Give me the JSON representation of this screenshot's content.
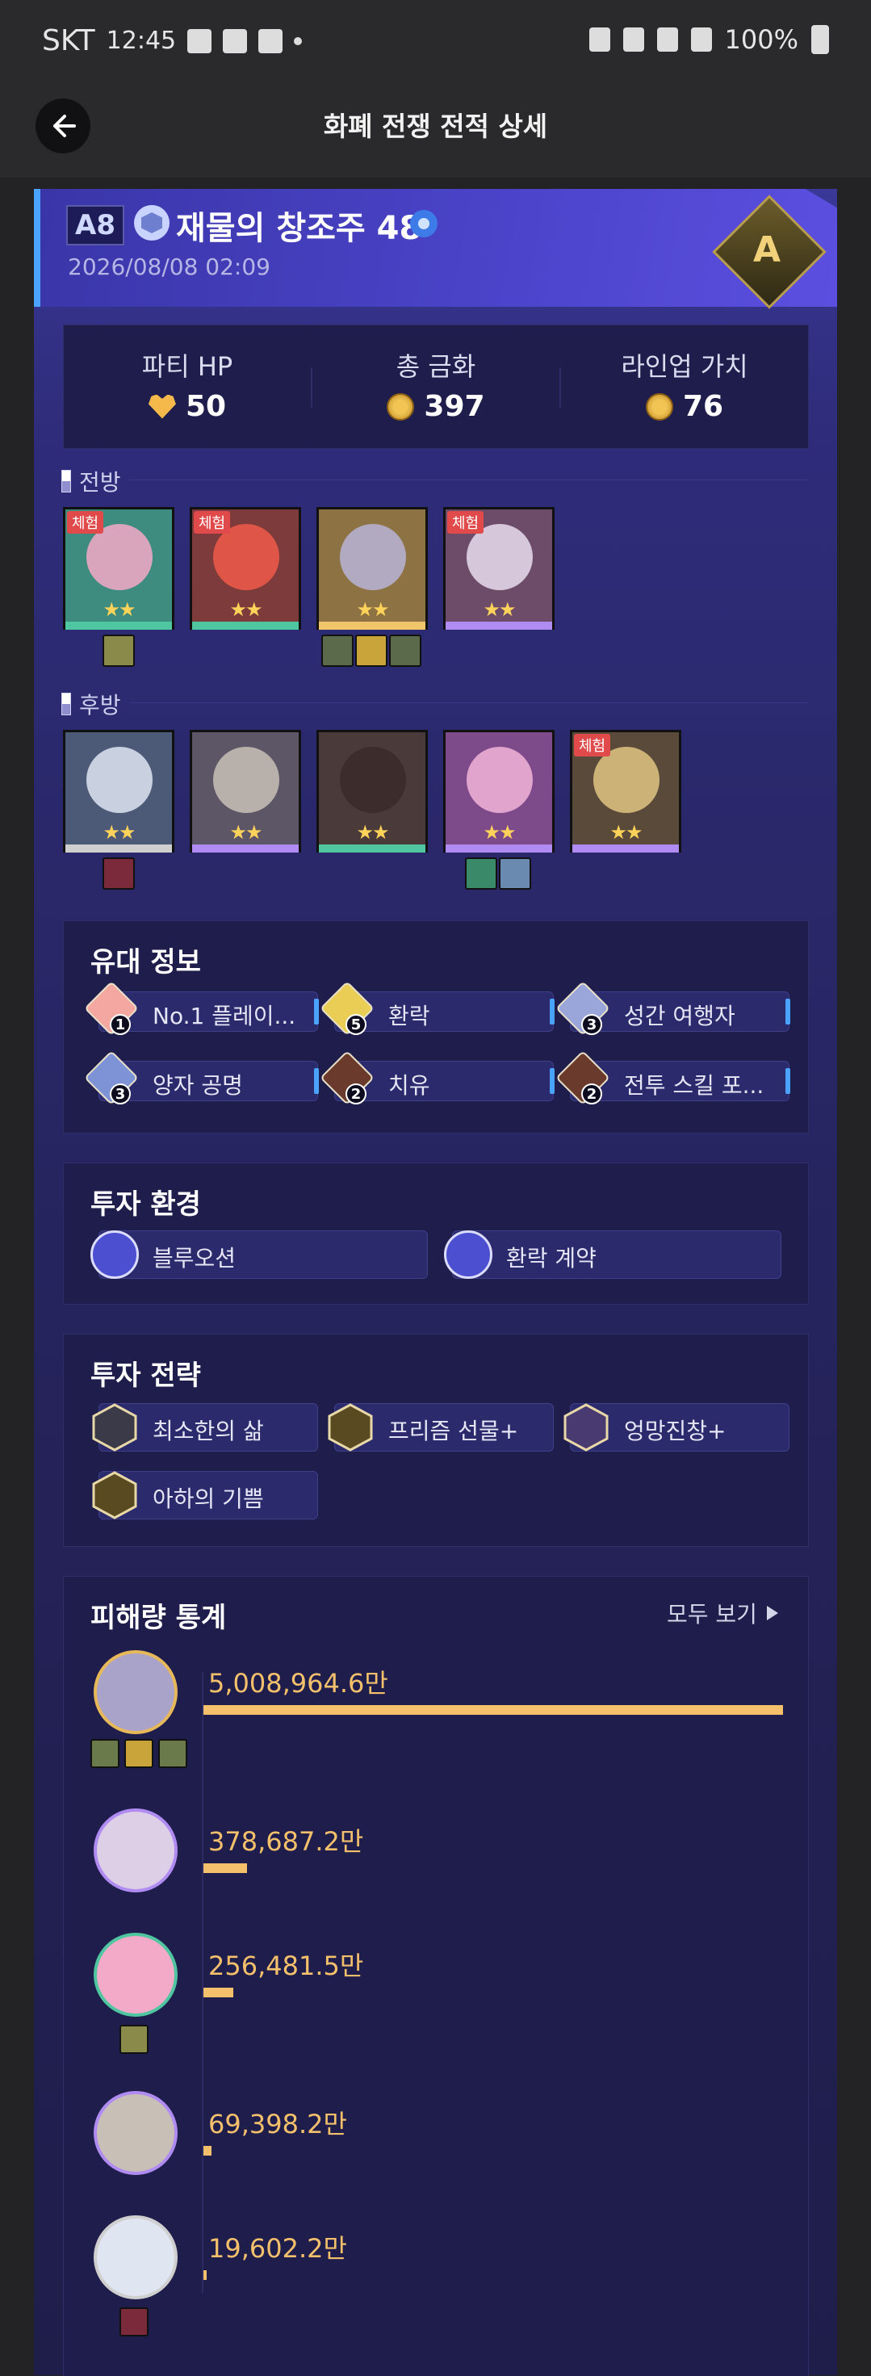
{
  "status_bar": {
    "carrier": "SKT",
    "time": "12:45",
    "battery": "100%"
  },
  "header": {
    "title": "화폐 전쟁 전적 상세"
  },
  "run": {
    "rank": "A8",
    "title": "재물의 창조주 48",
    "date": "2026/08/08 02:09",
    "grade": "A"
  },
  "stats": [
    {
      "label": "파티 HP",
      "value": "50",
      "icon": "heart-icon"
    },
    {
      "label": "총 금화",
      "value": "397",
      "icon": "coin-icon"
    },
    {
      "label": "라인업 가치",
      "value": "76",
      "icon": "coin-icon"
    }
  ],
  "front": {
    "label": "전방"
  },
  "back": {
    "label": "후방"
  },
  "trial_tag": "체험",
  "front_chars": [
    {
      "color": "#4fc6a0",
      "bg": "#3e8c7f",
      "face": "#f3a9c8",
      "trial": true,
      "stars": "★★"
    },
    {
      "color": "#4fc6a0",
      "bg": "#7d3b3b",
      "face": "#f05a4a",
      "trial": true,
      "stars": "★★"
    },
    {
      "color": "#f1c66a",
      "bg": "#8d7244",
      "face": "#b7b4d6",
      "trial": false,
      "stars": "★★"
    },
    {
      "color": "#b08cf2",
      "bg": "#6d4c6a",
      "face": "#e9ddee",
      "trial": true,
      "stars": "★★"
    }
  ],
  "back_chars": [
    {
      "color": "#cfcfcf",
      "bg": "#4c5a78",
      "face": "#dfe6f2",
      "trial": false,
      "stars": "★★"
    },
    {
      "color": "#b08cf2",
      "bg": "#5d5666",
      "face": "#c8c0b6",
      "trial": false,
      "stars": "★★"
    },
    {
      "color": "#4fc6a0",
      "bg": "#4a3a3a",
      "face": "#3a2a2a",
      "trial": false,
      "stars": "★★"
    },
    {
      "color": "#b08cf2",
      "bg": "#7d4a8a",
      "face": "#f2b4d8",
      "trial": false,
      "stars": "★★"
    },
    {
      "color": "#b08cf2",
      "bg": "#5a4a3a",
      "face": "#e2c482",
      "trial": true,
      "stars": "★★"
    }
  ],
  "bond": {
    "title": "유대 정보",
    "items": [
      {
        "label": "No.1 플레이...",
        "count": "1",
        "color": "#f3a7a0"
      },
      {
        "label": "환락",
        "count": "5",
        "color": "#e9cd55"
      },
      {
        "label": "성간 여행자",
        "count": "3",
        "color": "#9aa6d9"
      },
      {
        "label": "양자 공명",
        "count": "3",
        "color": "#7d93d6"
      },
      {
        "label": "치유",
        "count": "2",
        "color": "#6a3b2c"
      },
      {
        "label": "전투 스킬 포...",
        "count": "2",
        "color": "#6a3b2c"
      }
    ]
  },
  "environment": {
    "title": "투자 환경",
    "items": [
      {
        "label": "블루오션",
        "color": "#4b4fd0"
      },
      {
        "label": "환락 계약",
        "color": "#4b4fd0"
      }
    ]
  },
  "strategy": {
    "title": "투자 전략",
    "items": [
      {
        "label": "최소한의 삶",
        "color": "#3a3a48"
      },
      {
        "label": "프리즘 선물+",
        "color": "#5a4a22"
      },
      {
        "label": "엉망진창+",
        "color": "#4a3a72"
      },
      {
        "label": "아하의 기쁨",
        "color": "#5a4a22"
      }
    ]
  },
  "damage": {
    "title": "피해량 통계",
    "view_all": "모두 보기",
    "rows": [
      {
        "value": "5,008,964.6만",
        "fraction": 1.0,
        "face": "#a9a3c9",
        "border": "#e7b85a"
      },
      {
        "value": "378,687.2만",
        "fraction": 0.0756,
        "face": "#ddd0e6",
        "border": "#b08cf2"
      },
      {
        "value": "256,481.5만",
        "fraction": 0.0512,
        "face": "#f3a9c8",
        "border": "#4fc6a0"
      },
      {
        "value": "69,398.2만",
        "fraction": 0.0139,
        "face": "#c8c0b6",
        "border": "#b08cf2"
      },
      {
        "value": "19,602.2만",
        "fraction": 0.0039,
        "face": "#dfe6f2",
        "border": "#cfcfcf"
      }
    ]
  }
}
